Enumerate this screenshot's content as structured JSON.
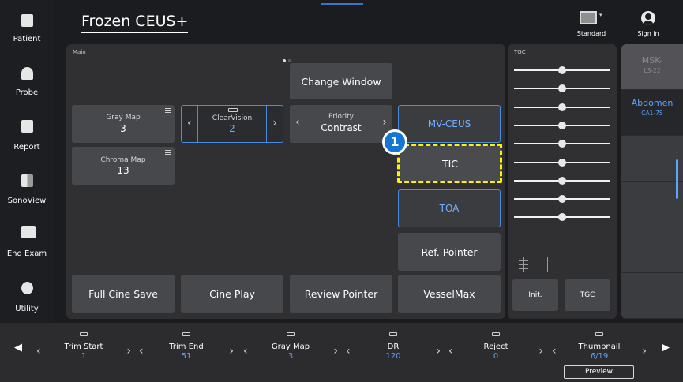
{
  "sidebar": {
    "items": [
      {
        "label": "Patient",
        "icon": "patient-icon"
      },
      {
        "label": "Probe",
        "icon": "probe-icon"
      },
      {
        "label": "Report",
        "icon": "report-icon"
      },
      {
        "label": "SonoView",
        "icon": "sonoview-icon"
      },
      {
        "label": "End Exam",
        "icon": "end-exam-icon"
      },
      {
        "label": "Utility",
        "icon": "gear-icon"
      }
    ]
  },
  "header": {
    "title": "Frozen CEUS+",
    "standard_label": "Standard",
    "signin_label": "Sign in"
  },
  "main": {
    "panel_label": "Main",
    "change_window": "Change Window",
    "gray_map": {
      "label": "Gray Map",
      "value": "3"
    },
    "chroma_map": {
      "label": "Chroma Map",
      "value": "13"
    },
    "clearvision": {
      "label": "ClearVision",
      "value": "2"
    },
    "priority": {
      "label": "Priority",
      "value": "Contrast"
    },
    "mv_ceus": "MV-CEUS",
    "tic": "TIC",
    "toa": "TOA",
    "ref_pointer": "Ref. Pointer",
    "full_cine_save": "Full Cine Save",
    "cine_play": "Cine Play",
    "review_pointer": "Review Pointer",
    "vesselmax": "VesselMax",
    "callout_number": "1",
    "highlight_color": "#fff300",
    "accent_color": "#4a8be0"
  },
  "tgc": {
    "panel_label": "TGC",
    "init_label": "Init.",
    "tgc_label": "TGC",
    "sliders": 9
  },
  "probes": [
    {
      "name": "MSK-",
      "model": "L3-22",
      "state": "dim"
    },
    {
      "name": "Abdomen",
      "model": "CA1-7S",
      "state": "active"
    },
    {
      "name": "",
      "model": "",
      "state": "normal"
    },
    {
      "name": "",
      "model": "",
      "state": "normal"
    },
    {
      "name": "",
      "model": "",
      "state": "normal"
    },
    {
      "name": "",
      "model": "",
      "state": "normal"
    }
  ],
  "bottom": {
    "knobs": [
      {
        "label": "Trim Start",
        "value": "1"
      },
      {
        "label": "Trim End",
        "value": "51"
      },
      {
        "label": "Gray Map",
        "value": "3"
      },
      {
        "label": "DR",
        "value": "120"
      },
      {
        "label": "Reject",
        "value": "0"
      },
      {
        "label": "Thumbnail",
        "value": "6/19"
      }
    ],
    "preview_label": "Preview"
  }
}
